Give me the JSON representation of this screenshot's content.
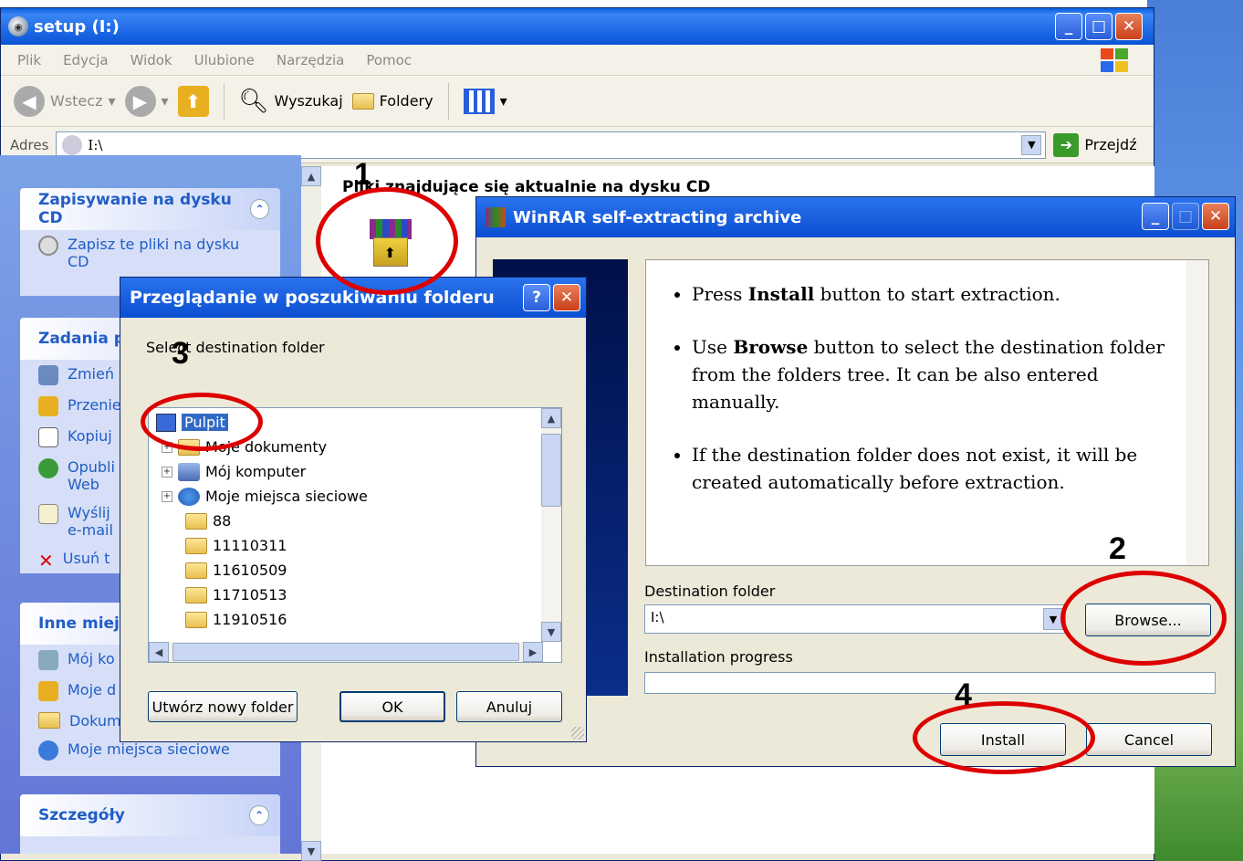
{
  "explorer": {
    "title": "setup (I:)",
    "menu": [
      "Plik",
      "Edycja",
      "Widok",
      "Ulubione",
      "Narzędzia",
      "Pomoc"
    ],
    "toolbar": {
      "back": "Wstecz",
      "search": "Wyszukaj",
      "folders": "Foldery"
    },
    "address": {
      "label": "Adres",
      "value": "I:\\",
      "go": "Przejdź"
    },
    "heading": "Pliki znajdujące się aktualnie na dysku CD",
    "left": {
      "panel1": {
        "title": "Zapisywanie na dysku CD",
        "item": "Zapisz te pliki na dysku CD"
      },
      "panel2": {
        "title": "Zadania p",
        "items": [
          "Zmień",
          "Przenie",
          "Kopiuj",
          "Opubli Web",
          "Wyślij e-mail",
          "Usuń t"
        ]
      },
      "panel3": {
        "title": "Inne miej",
        "items": [
          "Mój ko",
          "Moje d",
          "Dokum",
          "Moje miejsca sieciowe"
        ]
      },
      "panel4": {
        "title": "Szczegóły"
      }
    }
  },
  "winrar": {
    "title": "WinRAR self-extracting archive",
    "bullets": [
      {
        "pre": "Press ",
        "bold": "Install",
        "post": " button to start extraction."
      },
      {
        "pre": "Use ",
        "bold": "Browse",
        "post": " button to select the destination folder from the folders tree. It can be also entered manually."
      },
      {
        "pre": "",
        "bold": "",
        "post": "If the destination folder does not exist, it will be created automatically before extraction."
      }
    ],
    "dest_label": "Destination folder",
    "dest_value": "I:\\",
    "browse": "Browse...",
    "progress_label": "Installation progress",
    "progress": 0,
    "install": "Install",
    "cancel": "Cancel"
  },
  "browse_dialog": {
    "title": "Przeglądanie w poszukiwaniu folderu",
    "prompt": "Select destination folder",
    "tree": [
      "Pulpit",
      "Moje dokumenty",
      "Mój komputer",
      "Moje miejsca sieciowe",
      "88",
      "11110311",
      "11610509",
      "11710513",
      "11910516"
    ],
    "new_folder": "Utwórz nowy folder",
    "ok": "OK",
    "cancel": "Anuluj"
  },
  "annotations": [
    "1",
    "2",
    "3",
    "4"
  ],
  "colors": {
    "annotation_ring": "#dd0000",
    "xp_blue": "#0b4fd0"
  }
}
